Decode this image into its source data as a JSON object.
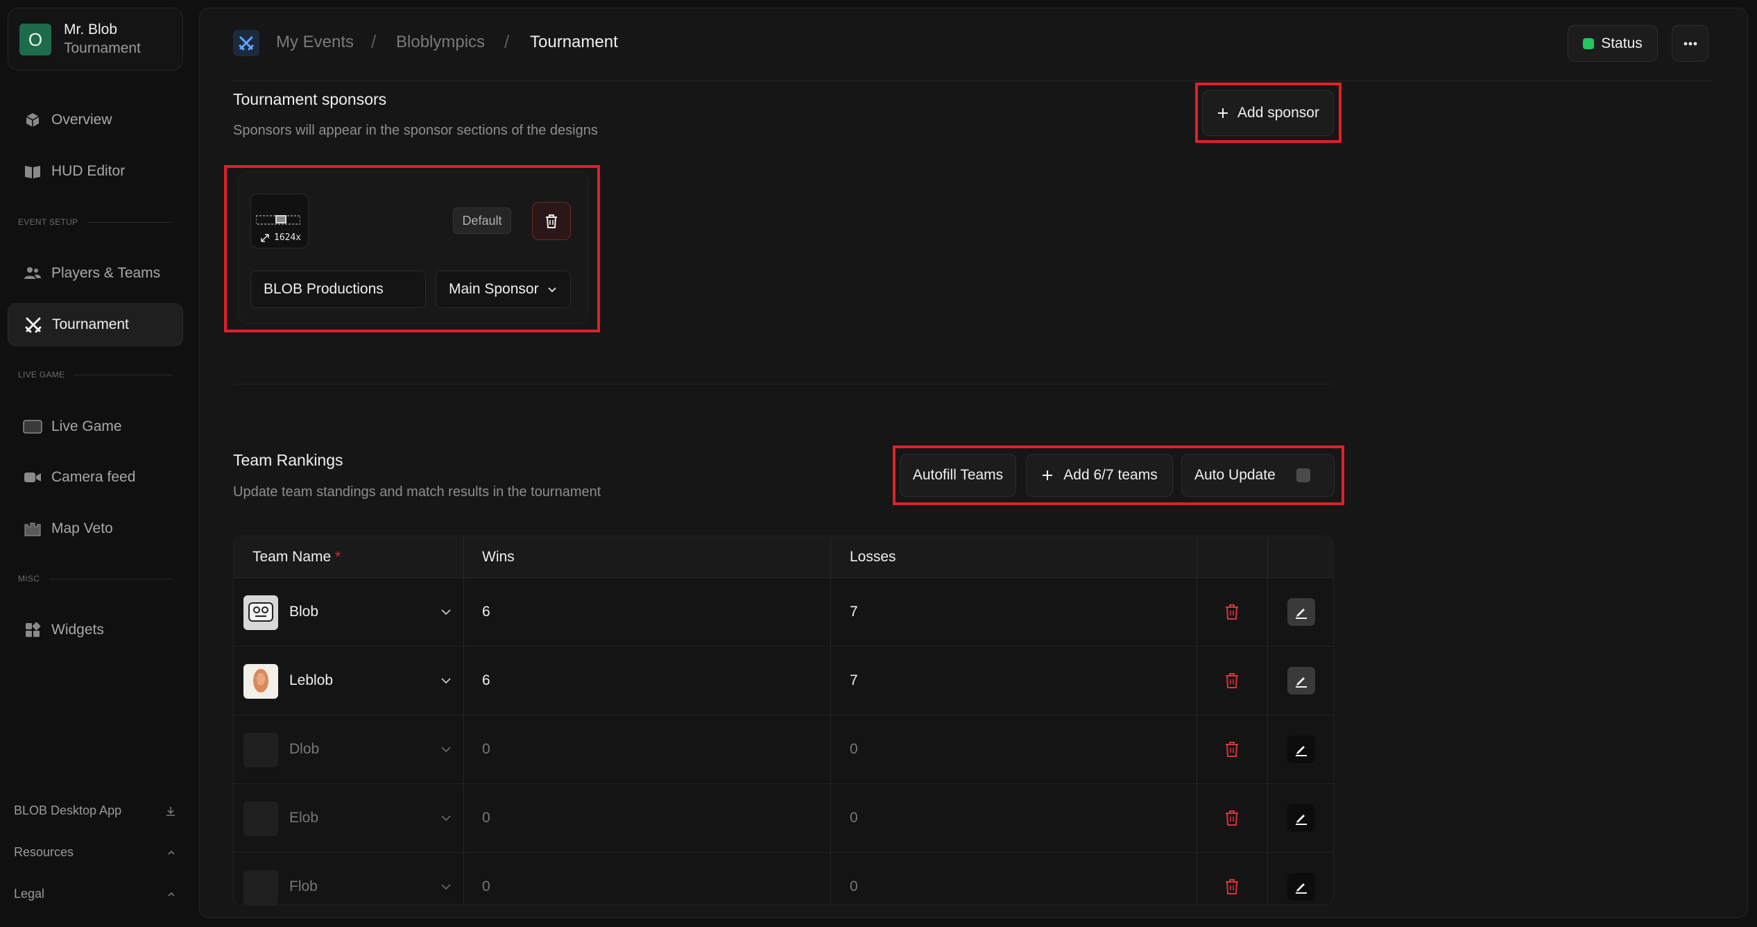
{
  "account": {
    "initial": "O",
    "name": "Mr. Blob",
    "subtitle": "Tournament"
  },
  "sidebar": {
    "overview": "Overview",
    "hud_editor": "HUD Editor",
    "section_event_setup": "EVENT SETUP",
    "players_teams": "Players & Teams",
    "tournament": "Tournament",
    "section_live_game": "LIVE GAME",
    "live_game": "Live Game",
    "camera_feed": "Camera feed",
    "map_veto": "Map Veto",
    "section_misc": "MISC",
    "widgets": "Widgets",
    "desktop_app": "BLOB Desktop App",
    "resources": "Resources",
    "legal": "Legal"
  },
  "breadcrumb": {
    "item1": "My Events",
    "item2": "Bloblympics",
    "item3": "Tournament",
    "sep": "/"
  },
  "header": {
    "status_label": "Status",
    "status_color": "#22c55e"
  },
  "sponsors": {
    "title": "Tournament sponsors",
    "description": "Sponsors will appear in the sponsor sections of the designs",
    "add_label": "Add sponsor",
    "card": {
      "image_size": "1624x",
      "badge": "Default",
      "name": "BLOB Productions",
      "type": "Main Sponsor"
    }
  },
  "rankings": {
    "title": "Team Rankings",
    "description": "Update team standings and match results in the tournament",
    "autofill_label": "Autofill Teams",
    "add_teams_label": "Add 6/7 teams",
    "auto_update_label": "Auto Update",
    "auto_update_on": false,
    "columns": {
      "team": "Team Name",
      "required": "*",
      "wins": "Wins",
      "losses": "Losses"
    },
    "rows": [
      {
        "name": "Blob",
        "wins": "6",
        "losses": "7"
      },
      {
        "name": "Leblob",
        "wins": "6",
        "losses": "7"
      },
      {
        "name": "Dlob",
        "wins": "0",
        "losses": "0"
      },
      {
        "name": "Elob",
        "wins": "0",
        "losses": "0"
      },
      {
        "name": "Flob",
        "wins": "0",
        "losses": "0"
      }
    ]
  },
  "colors": {
    "accent_red": "#e0202a",
    "delete_red": "#d8343a",
    "brand_blue": "#3b82f6"
  }
}
